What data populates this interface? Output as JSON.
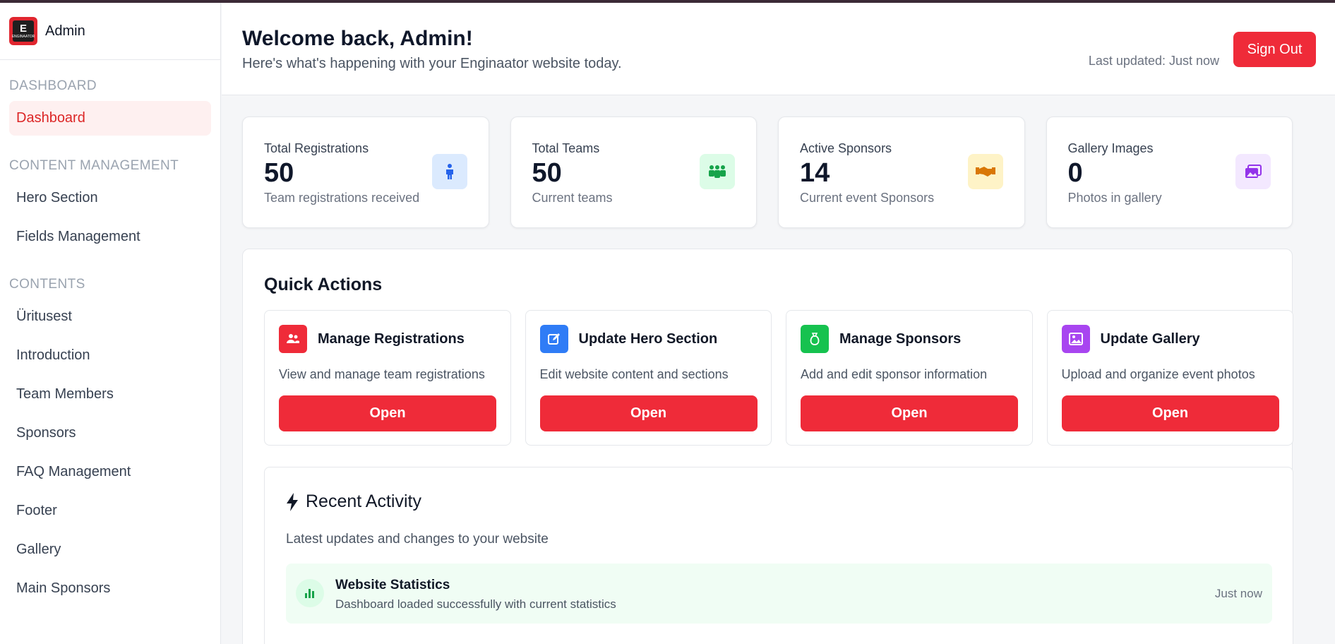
{
  "brand": {
    "name": "Admin",
    "logo_letter": "E",
    "logo_sub": "ENGINAATOR"
  },
  "sidebar": {
    "sections": [
      {
        "title": "Dashboard",
        "items": [
          {
            "label": "Dashboard",
            "active": true
          }
        ]
      },
      {
        "title": "Content Management",
        "items": [
          {
            "label": "Hero Section"
          },
          {
            "label": "Fields Management"
          }
        ]
      },
      {
        "title": "Contents",
        "items": [
          {
            "label": "Üritusest"
          },
          {
            "label": "Introduction"
          },
          {
            "label": "Team Members"
          },
          {
            "label": "Sponsors"
          },
          {
            "label": "FAQ Management"
          },
          {
            "label": "Footer"
          },
          {
            "label": "Gallery"
          },
          {
            "label": "Main Sponsors"
          }
        ]
      }
    ]
  },
  "header": {
    "welcome": "Welcome back, Admin!",
    "subtitle": "Here's what's happening with your Enginaator website today.",
    "last_updated": "Last updated: Just now",
    "sign_out": "Sign Out"
  },
  "stats": [
    {
      "label": "Total Registrations",
      "value": "50",
      "desc": "Team registrations received",
      "icon": "person-icon",
      "color": "#2563eb",
      "bg": "#dbeafe"
    },
    {
      "label": "Total Teams",
      "value": "50",
      "desc": "Current teams",
      "icon": "users-icon",
      "color": "#16a34a",
      "bg": "#dcfce7"
    },
    {
      "label": "Active Sponsors",
      "value": "14",
      "desc": "Current event Sponsors",
      "icon": "handshake-icon",
      "color": "#d97706",
      "bg": "#fef3c7"
    },
    {
      "label": "Gallery Images",
      "value": "0",
      "desc": "Photos in gallery",
      "icon": "images-icon",
      "color": "#9333ea",
      "bg": "#f3e8ff"
    }
  ],
  "quick_actions": {
    "title": "Quick Actions",
    "items": [
      {
        "title": "Manage Registrations",
        "desc": "View and manage team registrations",
        "button": "Open",
        "icon": "users-icon",
        "color": "#ef2b39"
      },
      {
        "title": "Update Hero Section",
        "desc": "Edit website content and sections",
        "button": "Open",
        "icon": "edit-icon",
        "color": "#2f7cf6"
      },
      {
        "title": "Manage Sponsors",
        "desc": "Add and edit sponsor information",
        "button": "Open",
        "icon": "money-bag-icon",
        "color": "#16c24f"
      },
      {
        "title": "Update Gallery",
        "desc": "Upload and organize event photos",
        "button": "Open",
        "icon": "images-icon",
        "color": "#a845f0"
      }
    ]
  },
  "recent_activity": {
    "title": "Recent Activity",
    "subtitle": "Latest updates and changes to your website",
    "items": [
      {
        "title": "Website Statistics",
        "desc": "Dashboard loaded successfully with current statistics",
        "time": "Just now",
        "icon": "bar-chart-icon"
      }
    ]
  }
}
